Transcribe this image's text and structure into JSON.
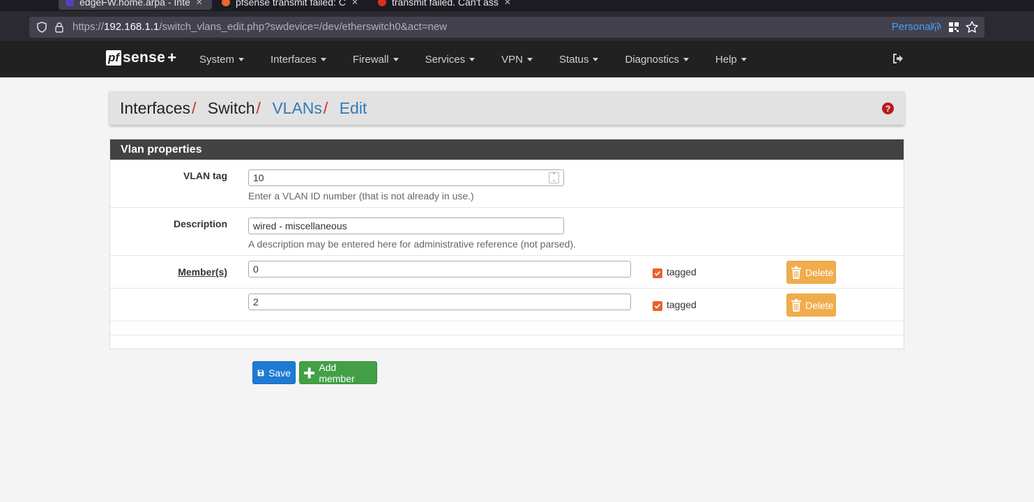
{
  "browser": {
    "tabs": [
      {
        "title": "edgeFW.home.arpa - Inte",
        "active": true
      },
      {
        "title": "pfsense transmit failed: C",
        "active": false
      },
      {
        "title": "transmit failed. Can't ass",
        "active": false
      }
    ],
    "url_scheme": "https://",
    "url_host": "192.168.1.1",
    "url_path": "/switch_vlans_edit.php?swdevice=/dev/etherswitch0&act=new",
    "profile_label": "Personal"
  },
  "header": {
    "logo_pf": "pf",
    "logo_sense": "sense",
    "logo_plus": "+",
    "menu": [
      "System",
      "Interfaces",
      "Firewall",
      "Services",
      "VPN",
      "Status",
      "Diagnostics",
      "Help"
    ]
  },
  "breadcrumb": {
    "items": [
      "Interfaces",
      "Switch",
      "VLANs",
      "Edit"
    ],
    "separator": "/"
  },
  "panel": {
    "title": "Vlan properties",
    "vlan_tag": {
      "label": "VLAN tag",
      "value": "10",
      "help": "Enter a VLAN ID number (that is not already in use.)"
    },
    "description": {
      "label": "Description",
      "value": "wired - miscellaneous",
      "help": "A description may be entered here for administrative reference (not parsed)."
    },
    "members_label": "Member(s)",
    "members": [
      {
        "value": "0",
        "tagged": true,
        "tagged_label": "tagged",
        "delete_label": "Delete"
      },
      {
        "value": "2",
        "tagged": true,
        "tagged_label": "tagged",
        "delete_label": "Delete"
      }
    ]
  },
  "actions": {
    "save_label": "Save",
    "add_member_label": "Add member"
  },
  "colors": {
    "header_bg": "#212121",
    "accent_red": "#c9302c",
    "link_blue": "#337ab7",
    "save_blue": "#1e7ad5",
    "add_green": "#43a047",
    "delete_orange": "#f0ad4e",
    "checkbox_orange": "#e8622c"
  }
}
